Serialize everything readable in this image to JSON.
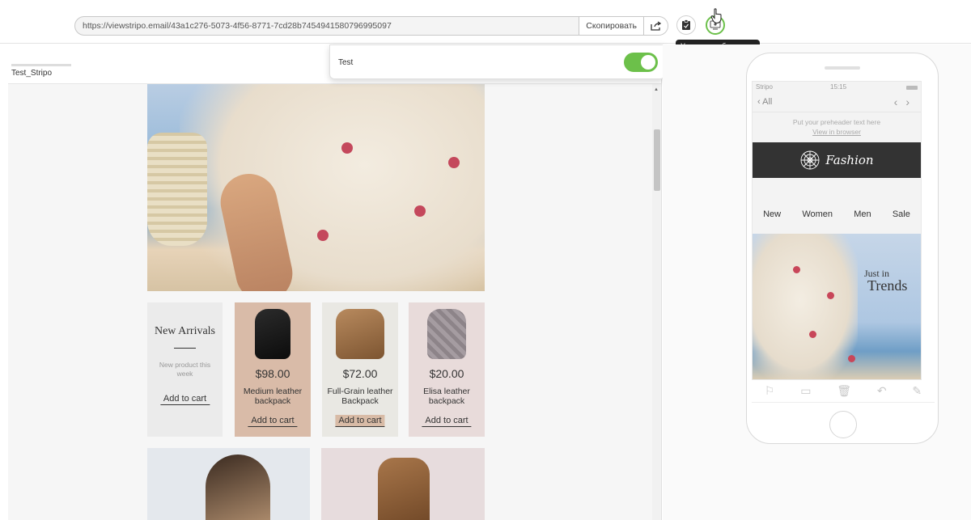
{
  "topbar": {
    "url": "https://viewstripo.email/43a1c276-5073-4f56-8771-7cd28b7454941580796995097",
    "copy_label": "Скопировать",
    "tooltip": "Условия отображения",
    "icons": [
      "share-icon",
      "clipboard-icon",
      "display-conditions-icon"
    ]
  },
  "desktop": {
    "tab_label": "Test_Stripo",
    "intro": {
      "title": "New Arrivals",
      "subtitle": "New product this week",
      "cart": "Add to cart"
    },
    "products": [
      {
        "price": "$98.00",
        "name": "Medium leather backpack",
        "cart": "Add to cart"
      },
      {
        "price": "$72.00",
        "name": "Full-Grain leather Backpack",
        "cart": "Add to cart"
      },
      {
        "price": "$20.00",
        "name": "Elisa leather backpack",
        "cart": "Add to cart"
      }
    ]
  },
  "popup": {
    "label": "Test",
    "toggle_on": true,
    "accent": "#6cc04a"
  },
  "mobile": {
    "carrier": "Stripo",
    "time": "15:15",
    "back_label": "All",
    "preheader": "Put your preheader text here",
    "view_in_browser": "View in browser",
    "logo_text": "Fashion",
    "menu": [
      "New",
      "Women",
      "Men",
      "Sale"
    ],
    "hero_small": "Just in",
    "hero_big": "Trends",
    "toolbar_icons": [
      "flag-icon",
      "folder-icon",
      "trash-icon",
      "reply-icon",
      "compose-icon"
    ]
  }
}
